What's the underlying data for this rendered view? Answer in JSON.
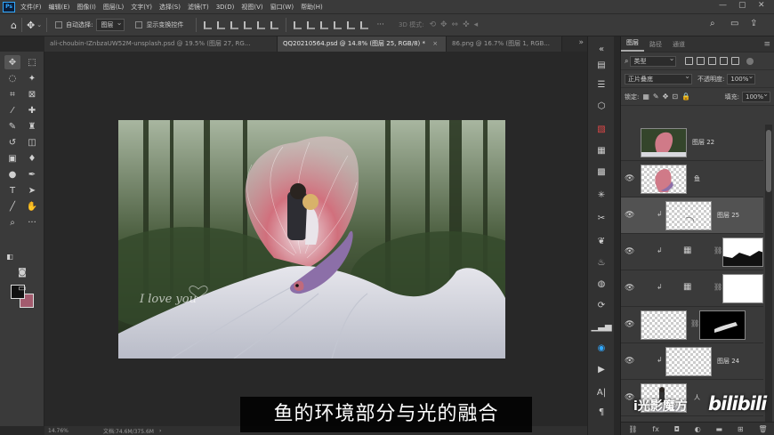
{
  "menubar": {
    "app_badge": "Ps",
    "items": [
      "文件(F)",
      "编辑(E)",
      "图像(I)",
      "图层(L)",
      "文字(Y)",
      "选择(S)",
      "滤镜(T)",
      "3D(D)",
      "视图(V)",
      "窗口(W)",
      "帮助(H)"
    ]
  },
  "options": {
    "auto_select_label": "自动选择:",
    "auto_select_value": "图层",
    "show_transform_label": "显示变换控件",
    "mode_3d_label": "3D 模式:"
  },
  "tabs": [
    {
      "label": "ali-choubin-IZnbzaUW52M-unsplash.psd @ 19.5% (图层 27, RG...",
      "active": false
    },
    {
      "label": "QQ20210564.psd @ 14.8% (图层 25, RGB/8) *",
      "active": true
    },
    {
      "label": "86.png @ 16.7% (图层 1, RGB...",
      "active": false
    }
  ],
  "canvas": {
    "script_text": "I love you"
  },
  "status": {
    "zoom": "14.76%",
    "doc_info": "文档:74.6M/375.6M"
  },
  "subtitle": "鱼的环境部分与光的融合",
  "layers_panel": {
    "tabs": [
      "图层",
      "路径",
      "通道"
    ],
    "filter_label": "类型",
    "blend_mode": "正片叠底",
    "opacity_label": "不透明度:",
    "opacity_value": "100%",
    "lock_label": "锁定:",
    "fill_label": "填充:",
    "fill_value": "100%",
    "layers": [
      {
        "name": "图层 22",
        "visible": false,
        "selected": false
      },
      {
        "name": "鱼",
        "visible": true,
        "selected": false
      },
      {
        "name": "图层 25",
        "visible": true,
        "selected": true
      },
      {
        "name": "",
        "visible": true,
        "selected": false
      },
      {
        "name": "",
        "visible": true,
        "selected": false
      },
      {
        "name": "",
        "visible": true,
        "selected": false
      },
      {
        "name": "图层 24",
        "visible": true,
        "selected": false
      },
      {
        "name": "人",
        "visible": true,
        "selected": false
      }
    ]
  },
  "watermark": {
    "channel": "i光影魔方",
    "brand": "bilibili"
  },
  "colors": {
    "foreground": "#111111",
    "background": "#a35b6e",
    "accent": "#31a8ff"
  }
}
